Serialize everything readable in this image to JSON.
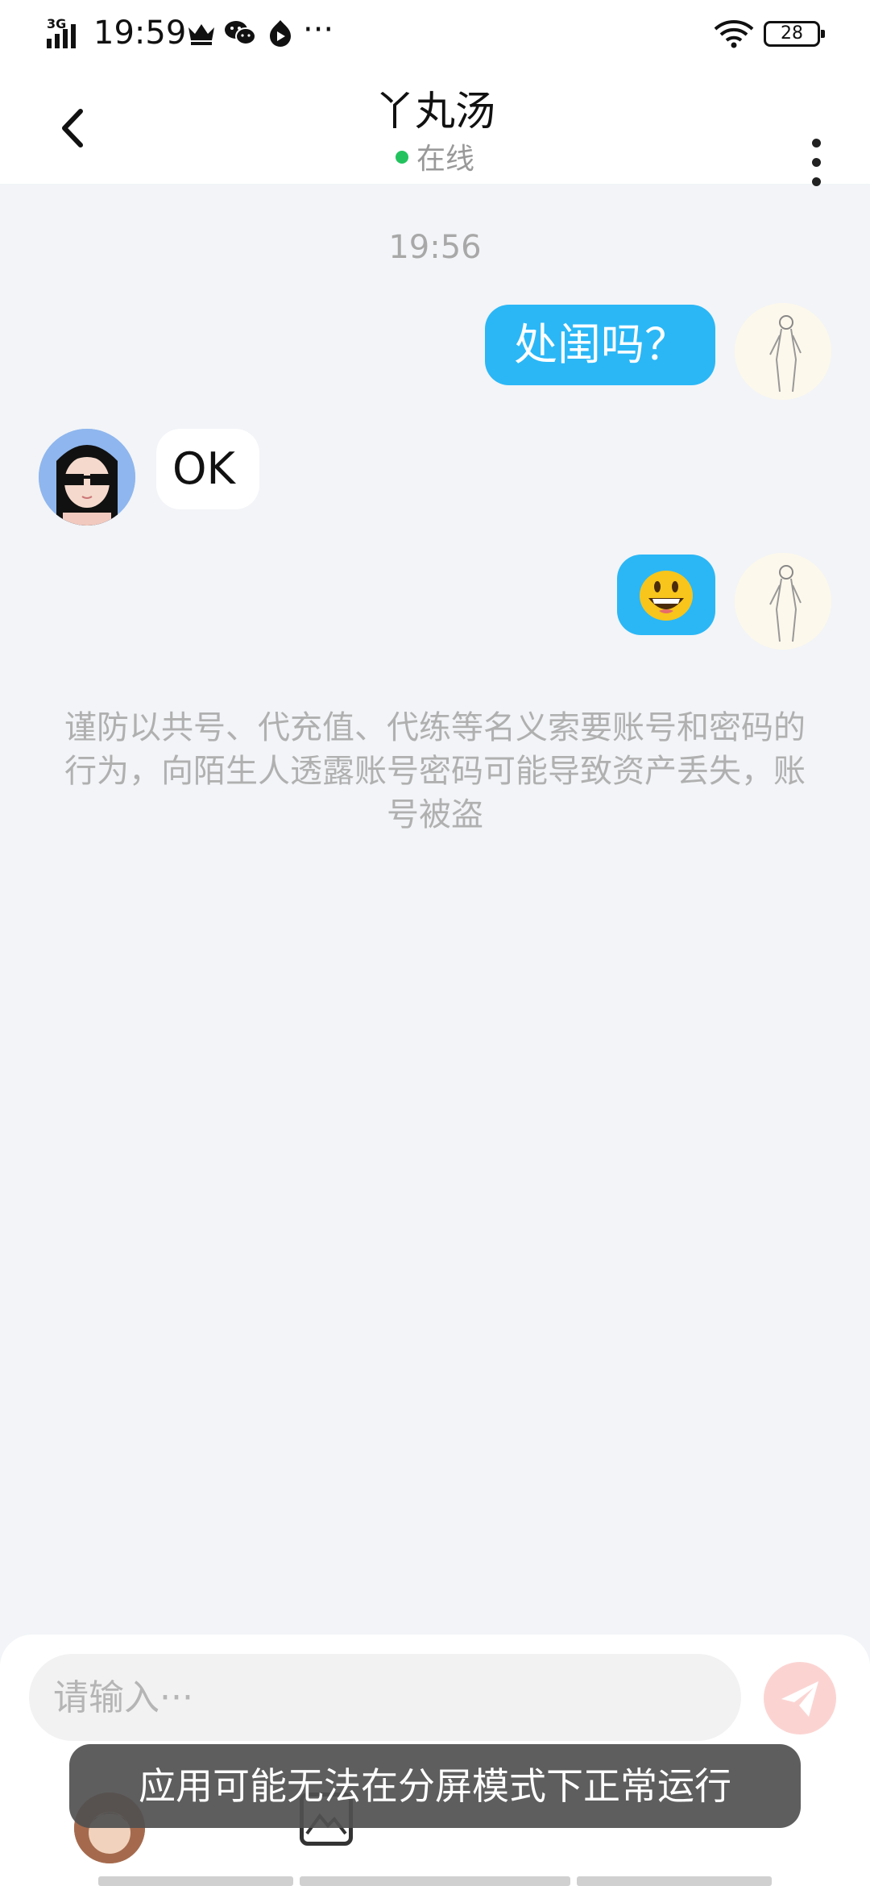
{
  "status_bar": {
    "network": "3G",
    "time": "19:59",
    "more": "···",
    "battery": "28"
  },
  "header": {
    "title": "丫丸汤",
    "status": "在线"
  },
  "chat": {
    "time": "19:56",
    "messages": [
      {
        "side": "mine",
        "text": "处闺吗？"
      },
      {
        "side": "theirs",
        "text": "OK"
      },
      {
        "side": "mine",
        "emoji": "grinning-face"
      }
    ],
    "notice": "谨防以共号、代充值、代练等名义索要账号和密码的行为，向陌生人透露账号密码可能导致资产丢失，账号被盗"
  },
  "input": {
    "placeholder": "请输入···",
    "value": ""
  },
  "toast": {
    "text": "应用可能无法在分屏模式下正常运行"
  },
  "colors": {
    "mine_bubble": "#2bb7f6",
    "background": "#f2f4f7",
    "online_dot": "#22c35e",
    "send_button": "#fbd4d2"
  }
}
